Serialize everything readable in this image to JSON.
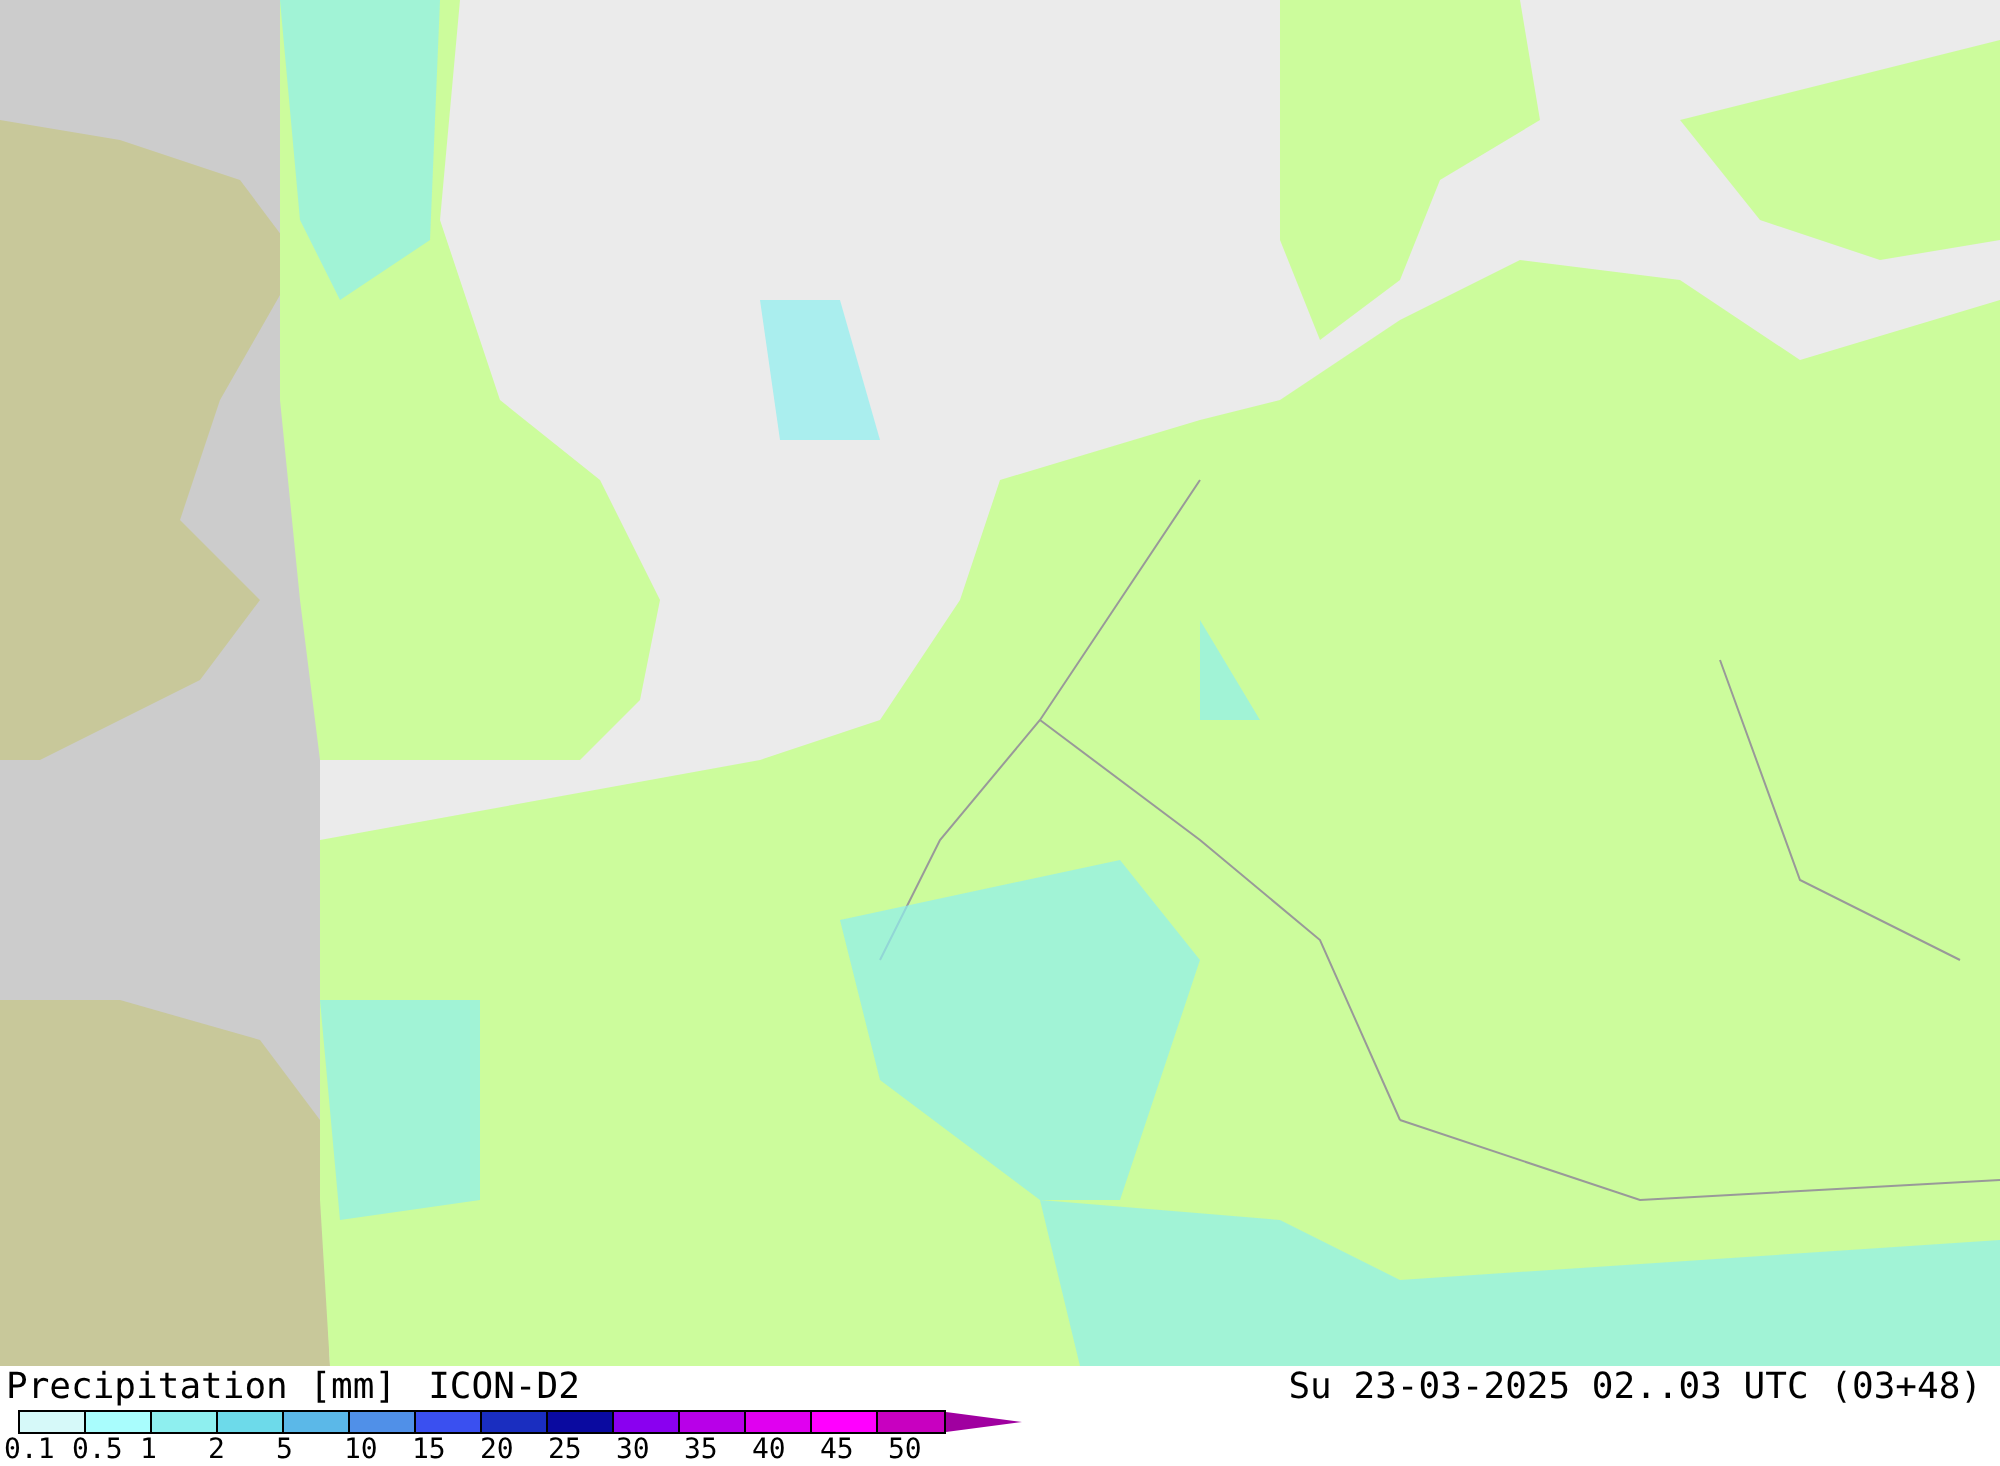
{
  "title": {
    "quantity": "Precipitation [mm]",
    "model": "ICON-D2",
    "valid_time": "Su 23-03-2025 02..03 UTC (03+48)"
  },
  "legend": {
    "steps": [
      {
        "label": "0.1",
        "color": "#d6f9f9"
      },
      {
        "label": "0.5",
        "color": "#a9fdfd"
      },
      {
        "label": "1",
        "color": "#8eefef"
      },
      {
        "label": "2",
        "color": "#6ddaea"
      },
      {
        "label": "5",
        "color": "#5bb8e8"
      },
      {
        "label": "10",
        "color": "#5090e8"
      },
      {
        "label": "15",
        "color": "#3a50f0"
      },
      {
        "label": "20",
        "color": "#1a2ec0"
      },
      {
        "label": "25",
        "color": "#0a0aa0"
      },
      {
        "label": "30",
        "color": "#8a00f0"
      },
      {
        "label": "35",
        "color": "#b800e8"
      },
      {
        "label": "40",
        "color": "#e000f0"
      },
      {
        "label": "45",
        "color": "#ff00ff"
      },
      {
        "label": "50",
        "color": "#c800c0"
      }
    ],
    "overflow": {
      "color": "#a000a0"
    }
  }
}
